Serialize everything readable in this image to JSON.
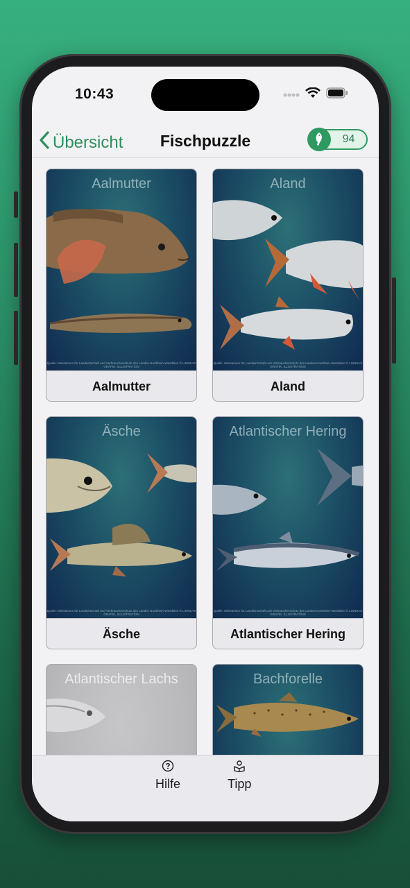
{
  "status_bar": {
    "time": "10:43"
  },
  "nav": {
    "back_label": "Übersicht",
    "title": "Fischpuzzle",
    "score": "94"
  },
  "cards": [
    {
      "art_title": "Aalmutter",
      "label": "Aalmutter",
      "credit": "Quelle: Ministerium für Landwirtschaft und Verbraucherschutz des Landes Nordrhein-Westfalen © LINNEAS GRAFIK, ILLUSTRATION"
    },
    {
      "art_title": "Aland",
      "label": "Aland",
      "credit": "Quelle: Ministerium für Landwirtschaft und Verbraucherschutz des Landes Nordrhein-Westfalen © LINNEAS GRAFIK, ILLUSTRATION"
    },
    {
      "art_title": "Äsche",
      "label": "Äsche",
      "credit": "Quelle: Ministerium für Landwirtschaft und Verbraucherschutz des Landes Nordrhein-Westfalen © LINNEAS GRAFIK, ILLUSTRATION"
    },
    {
      "art_title": "Atlantischer Hering",
      "label": "Atlantischer Hering",
      "credit": "Quelle: Ministerium für Landwirtschaft und Verbraucherschutz des Landes Nordrhein-Westfalen © LINNEAS GRAFIK, ILLUSTRATION"
    },
    {
      "art_title": "Atlantischer Lachs",
      "label": ""
    },
    {
      "art_title": "Bachforelle",
      "label": ""
    }
  ],
  "tab_bar": {
    "help_label": "Hilfe",
    "tip_label": "Tipp"
  },
  "colors": {
    "accent": "#2e8f5e",
    "card_bg": "#1c4f66"
  },
  "icons": [
    "back-chevron-icon",
    "fish-icon",
    "question-circle-icon",
    "tip-icon",
    "wifi-icon",
    "battery-icon",
    "signal-icon"
  ]
}
